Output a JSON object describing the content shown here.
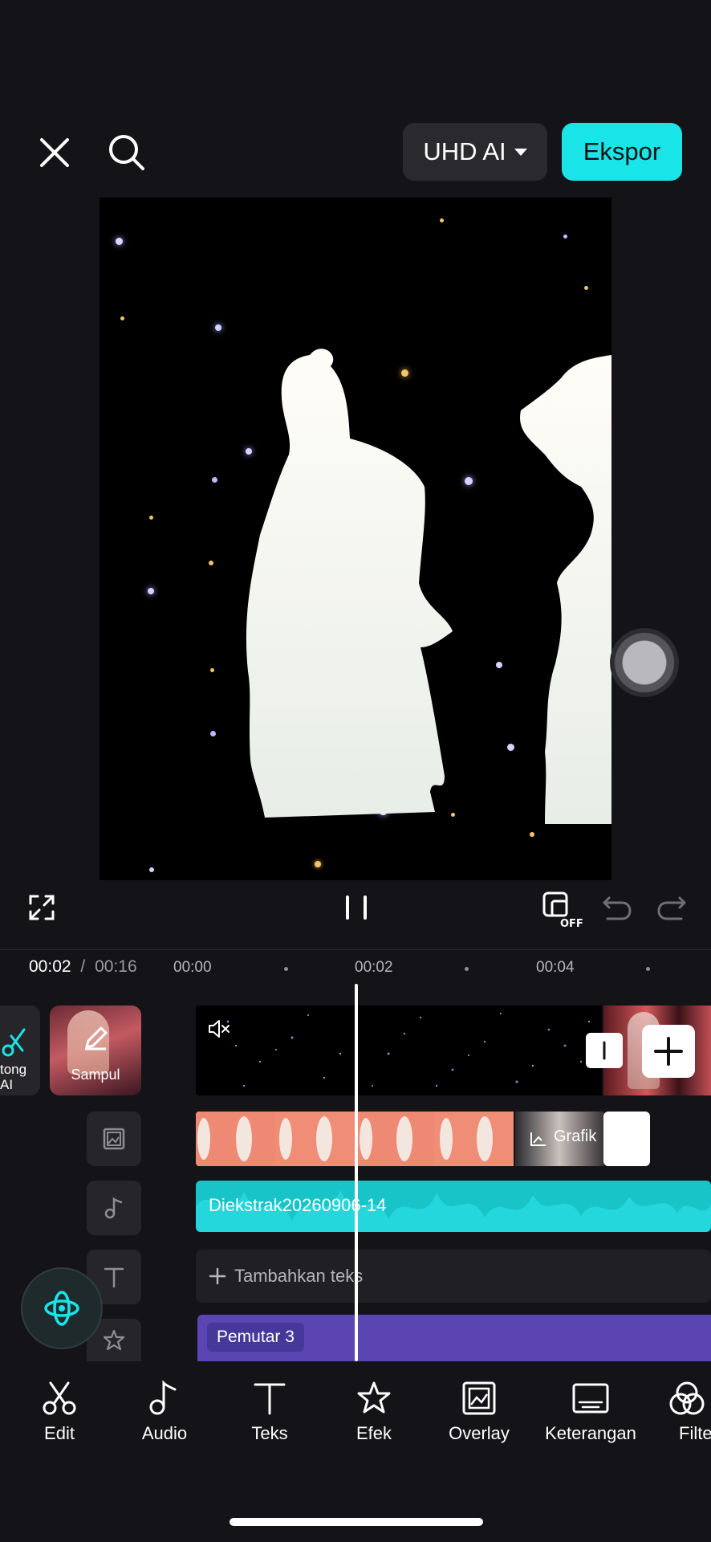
{
  "header": {
    "quality_label": "UHD AI",
    "export_label": "Ekspor"
  },
  "timeline": {
    "current_time": "00:02",
    "separator": "/",
    "total_time": "00:16",
    "ticks": [
      "00:00",
      "00:02",
      "00:04"
    ]
  },
  "tracks": {
    "ai_cut_label": "Potong AI",
    "ai_cut_visible": "tong\nAI",
    "cover_label": "Sampul",
    "overlay_clip_label": "Grafik",
    "audio_clip_label": "Diekstrak20260906-14",
    "add_text_label": "Tambahkan teks",
    "effect_clip_label": "Pemutar 3"
  },
  "toolbar": {
    "items": [
      {
        "label": "Edit",
        "icon": "scissors-icon"
      },
      {
        "label": "Audio",
        "icon": "music-note-icon"
      },
      {
        "label": "Teks",
        "icon": "text-icon"
      },
      {
        "label": "Efek",
        "icon": "star-effect-icon"
      },
      {
        "label": "Overlay",
        "icon": "overlay-icon"
      },
      {
        "label": "Keterangan",
        "icon": "caption-icon"
      },
      {
        "label": "Filte",
        "icon": "filter-icon"
      }
    ]
  },
  "colors": {
    "accent": "#19e4e8",
    "audio_track": "#19c4c8",
    "effect_track": "#5a45b2",
    "background": "#141418"
  }
}
